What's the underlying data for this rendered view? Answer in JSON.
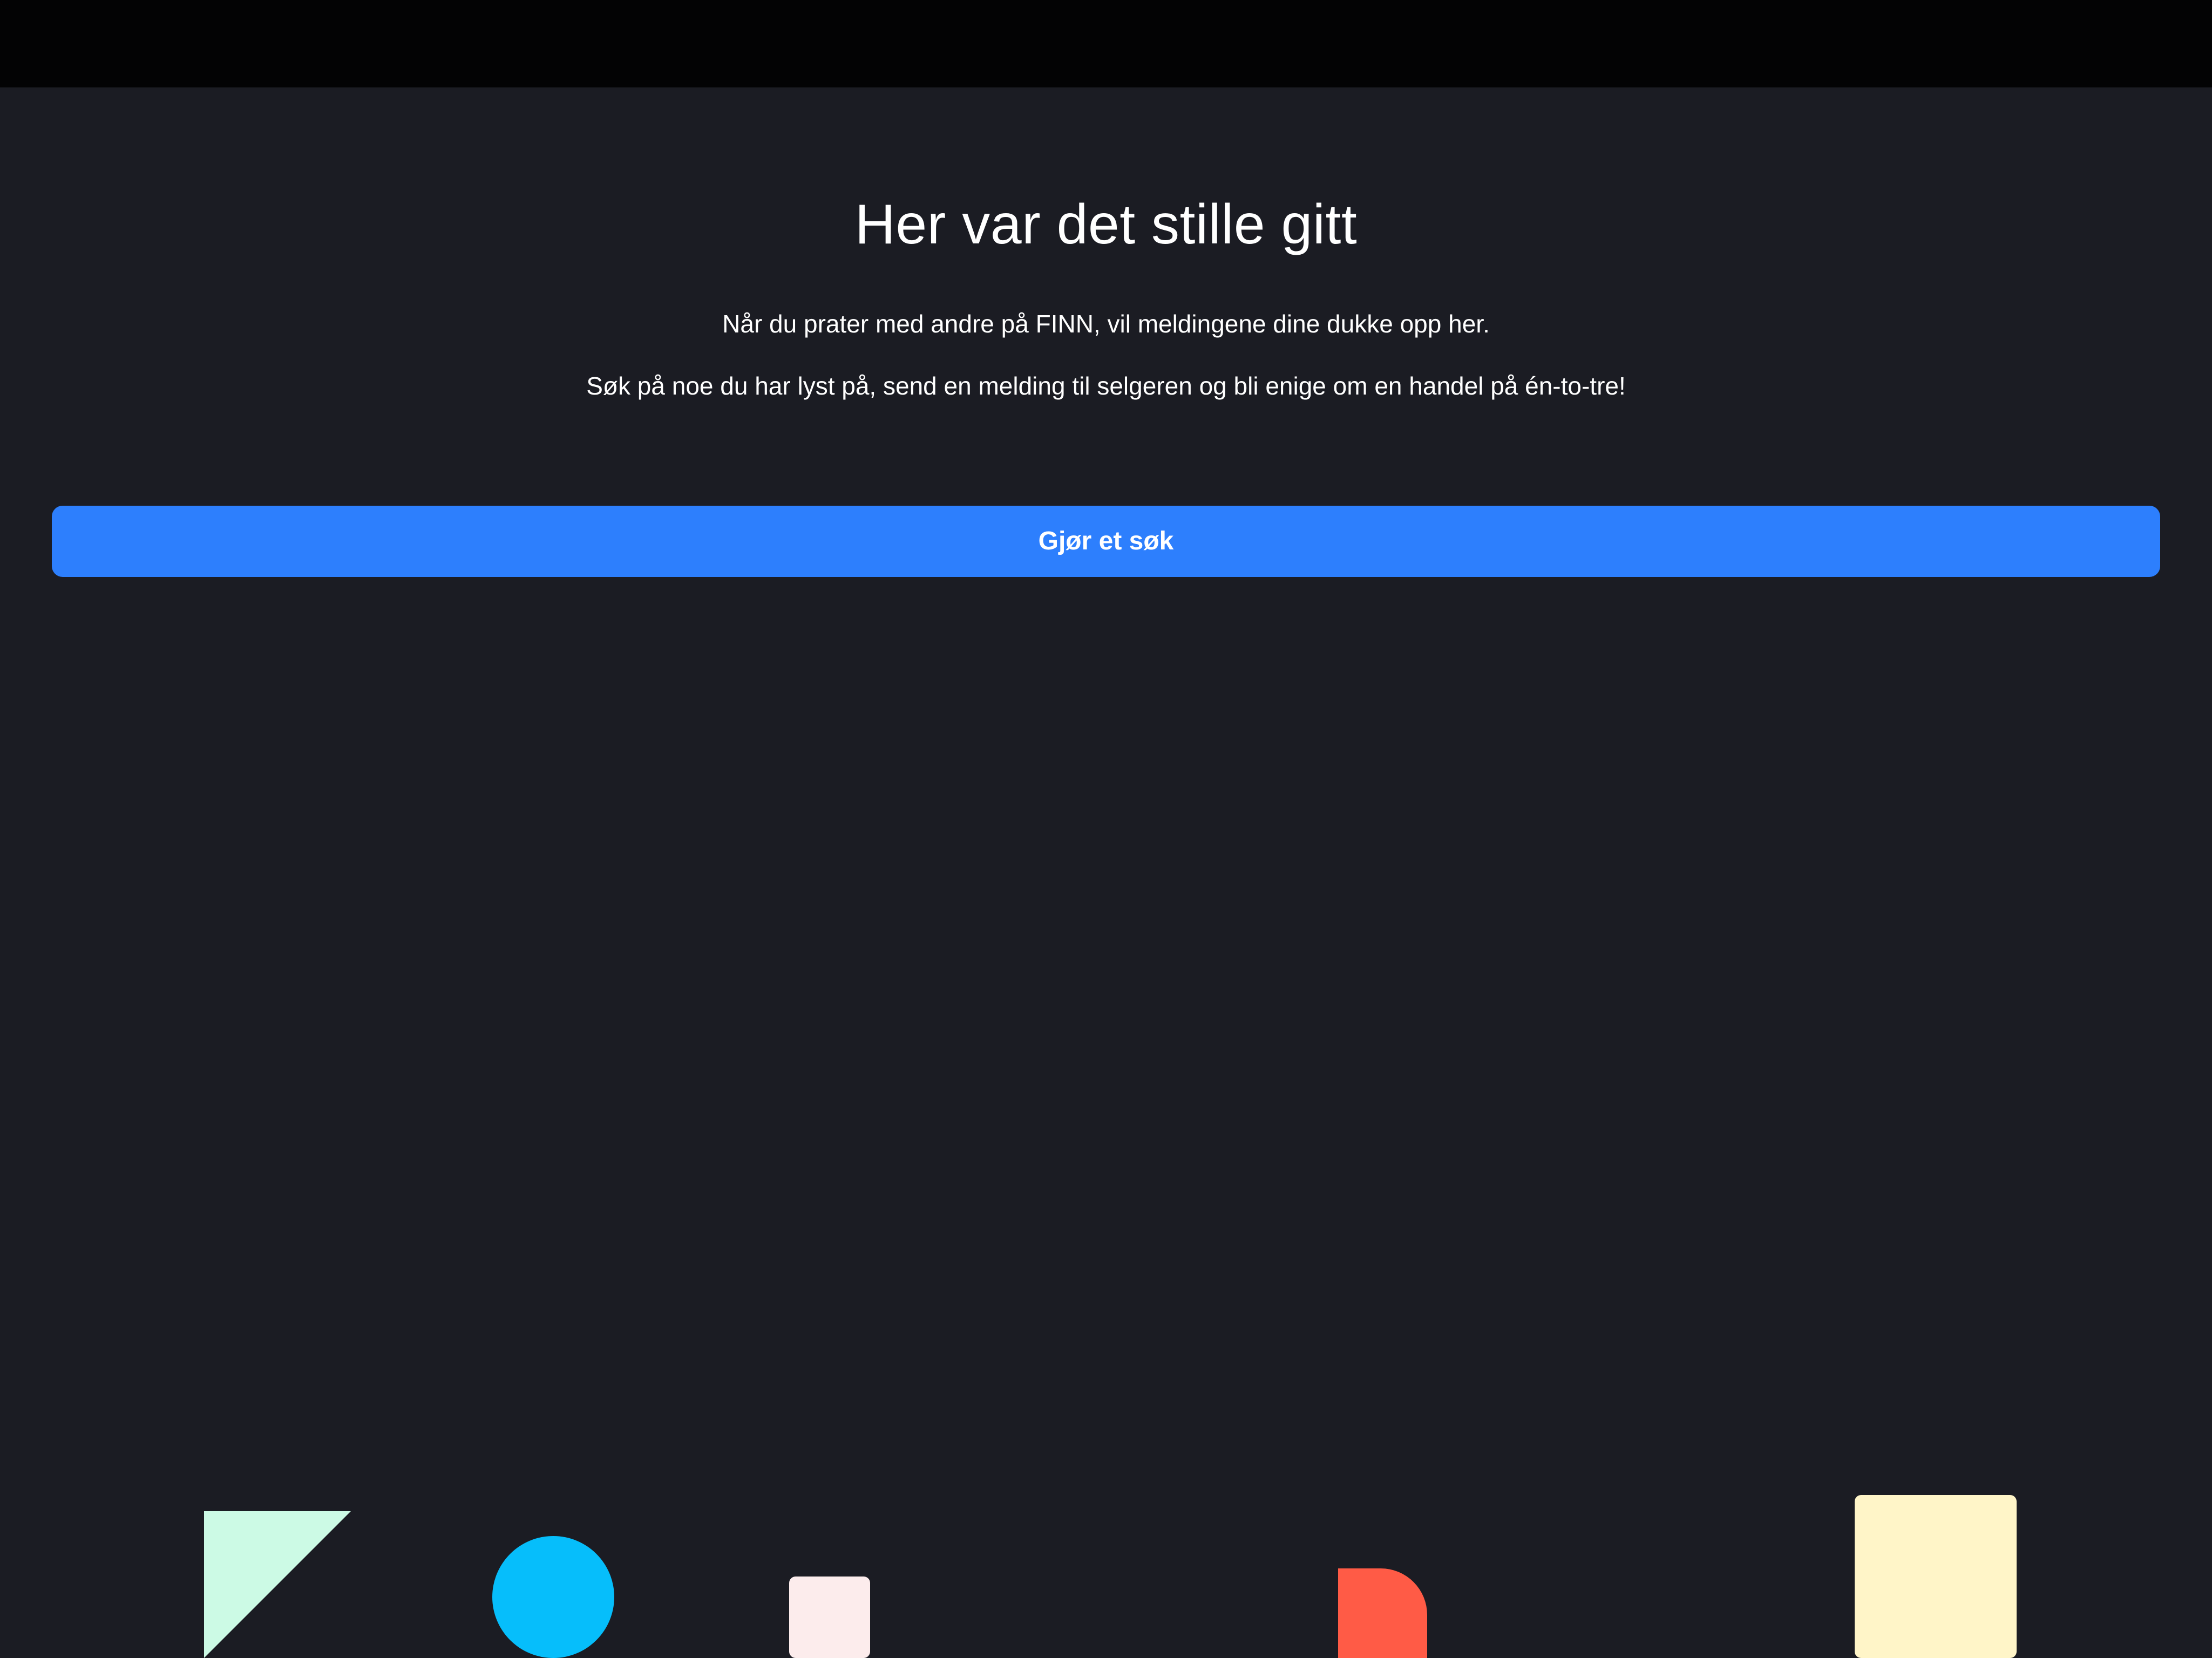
{
  "empty_state": {
    "title": "Her var det stille gitt",
    "paragraph_1": "Når du prater med andre på FINN, vil meldingene dine dukke opp her.",
    "paragraph_2": "Søk på noe du har lyst på, send en melding til selgeren og bli enige om en handel på én-to-tre!",
    "search_button_label": "Gjør et søk"
  },
  "colors": {
    "status_bar": "#030304",
    "background": "#1b1c23",
    "accent": "#2d7ffd",
    "text": "#ffffff",
    "shape_triangle": "#ccfae5",
    "shape_circle": "#06befb",
    "shape_square_small": "#fcecec",
    "shape_arch": "#ff5b46",
    "shape_square_large": "#fff5c8"
  }
}
